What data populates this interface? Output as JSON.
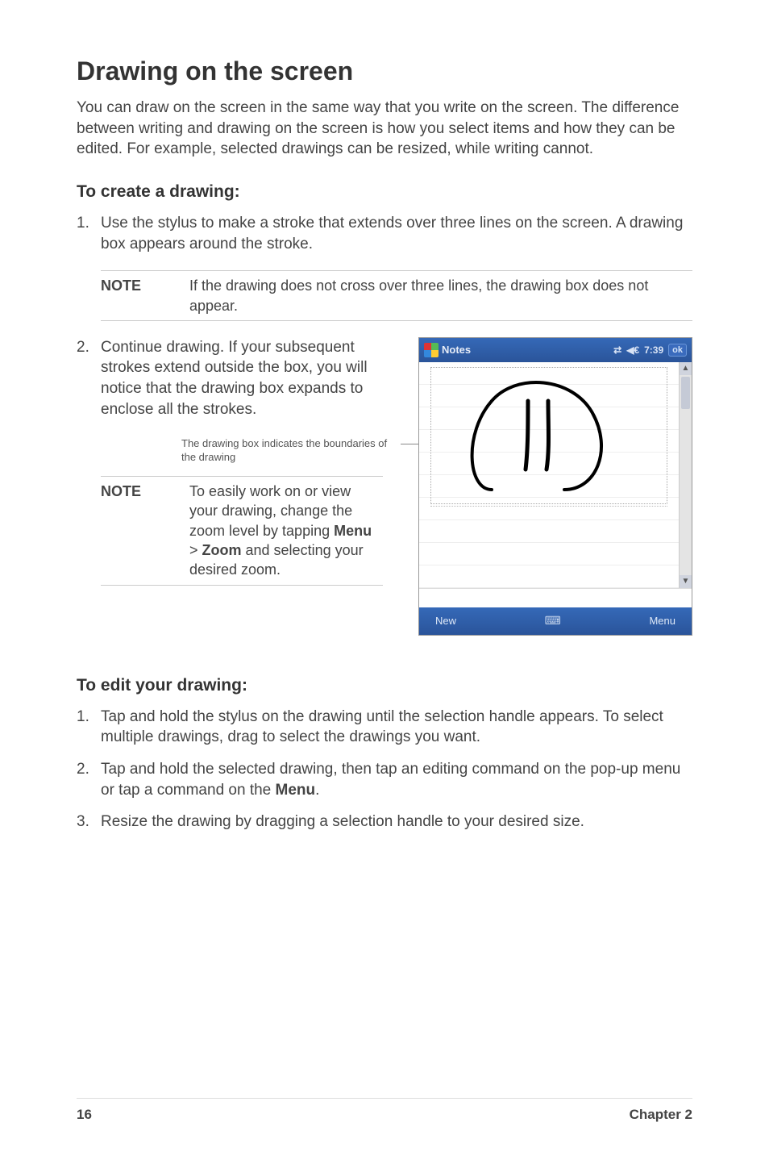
{
  "heading": "Drawing on the screen",
  "intro": "You can draw on the screen in the same way that you write on the screen. The difference between writing and drawing on the screen is how you select items and how they can be edited. For example, selected drawings can be resized, while writing cannot.",
  "section1": {
    "title": "To create a drawing:",
    "step1": "Use the stylus to make a stroke that extends over three lines on the screen. A drawing box appears around the stroke.",
    "note1_label": "NOTE",
    "note1_text": "If the drawing does not cross over three lines, the drawing box does not appear.",
    "step2": "Continue drawing. If your subsequent strokes extend outside the box, you will notice that the drawing box expands to enclose all the strokes.",
    "callout": "The drawing box indicates the boundaries of the drawing",
    "note2_label": "NOTE",
    "note2_text_pre": "To easily work on or view your drawing, change the zoom level by tapping ",
    "note2_menu": "Menu",
    "note2_gt": " > ",
    "note2_zoom": "Zoom",
    "note2_text_post": " and selecting your desired zoom."
  },
  "device": {
    "app_title": "Notes",
    "time": "7:39",
    "ok": "ok",
    "footer_new": "New",
    "footer_menu": "Menu"
  },
  "section2": {
    "title": "To edit your drawing:",
    "step1": "Tap and hold the stylus on the drawing until the selection handle appears. To select multiple drawings, drag to select the drawings you want.",
    "step2_pre": "Tap and hold the selected drawing, then tap an editing command on the pop-up menu or tap a command on the ",
    "step2_menu": "Menu",
    "step2_post": ".",
    "step3": "Resize the drawing by dragging a selection handle to your desired size."
  },
  "footer": {
    "page_num": "16",
    "chapter": "Chapter 2"
  }
}
